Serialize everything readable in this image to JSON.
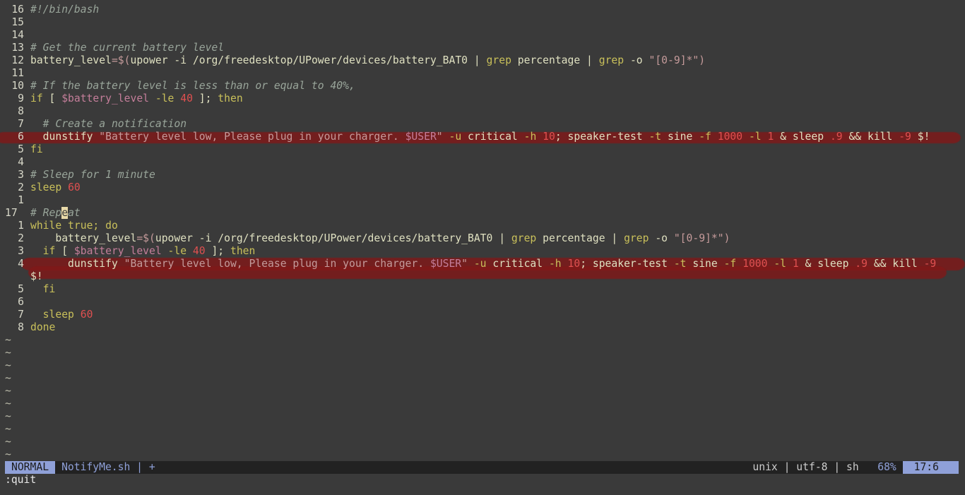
{
  "editor": {
    "lines": [
      {
        "num": "16",
        "tokens": [
          {
            "t": "#!/bin/bash",
            "c": "cm"
          }
        ]
      },
      {
        "num": "15",
        "tokens": []
      },
      {
        "num": "14",
        "tokens": []
      },
      {
        "num": "13",
        "tokens": [
          {
            "t": "# Get the current battery level",
            "c": "cm"
          }
        ]
      },
      {
        "num": "12",
        "tokens": [
          {
            "t": "battery_level",
            "c": "fn"
          },
          {
            "t": "=$(",
            "c": "str"
          },
          {
            "t": "upower ",
            "c": "fn"
          },
          {
            "t": "-i /org/freedesktop/UPower/devices/battery_BAT0 ",
            "c": "fn"
          },
          {
            "t": "| ",
            "c": "fn"
          },
          {
            "t": "grep ",
            "c": "kw"
          },
          {
            "t": "percentage ",
            "c": "fn"
          },
          {
            "t": "| ",
            "c": "fn"
          },
          {
            "t": "grep ",
            "c": "kw"
          },
          {
            "t": "-o ",
            "c": "fn"
          },
          {
            "t": "\"[0-9]*\")",
            "c": "str"
          }
        ]
      },
      {
        "num": "11",
        "tokens": []
      },
      {
        "num": "10",
        "tokens": [
          {
            "t": "# If the battery level is less than or equal to 40%,",
            "c": "cm"
          }
        ]
      },
      {
        "num": "9",
        "tokens": [
          {
            "t": "if",
            "c": "kw"
          },
          {
            "t": " [ ",
            "c": "fn"
          },
          {
            "t": "$battery_level",
            "c": "vr"
          },
          {
            "t": " -le ",
            "c": "fl"
          },
          {
            "t": "40",
            "c": "num"
          },
          {
            "t": " ]; ",
            "c": "fn"
          },
          {
            "t": "then",
            "c": "kw"
          }
        ]
      },
      {
        "num": "8",
        "tokens": []
      },
      {
        "num": "7",
        "tokens": [
          {
            "t": "  # Create a notification",
            "c": "cm"
          }
        ]
      },
      {
        "num": "6",
        "redact": true,
        "tokens": [
          {
            "t": "  dunstify ",
            "c": "fn"
          },
          {
            "t": "\"Battery level low, Please plug in your charger. ",
            "c": "str"
          },
          {
            "t": "$USER",
            "c": "vr"
          },
          {
            "t": "\"",
            "c": "str"
          },
          {
            "t": " -u ",
            "c": "fl"
          },
          {
            "t": "critical ",
            "c": "fn"
          },
          {
            "t": "-h ",
            "c": "fl"
          },
          {
            "t": "10",
            "c": "num"
          },
          {
            "t": "; speaker-test ",
            "c": "fn"
          },
          {
            "t": "-t ",
            "c": "fl"
          },
          {
            "t": "sine ",
            "c": "fn"
          },
          {
            "t": "-f ",
            "c": "fl"
          },
          {
            "t": "1000",
            "c": "num"
          },
          {
            "t": " -l ",
            "c": "fl"
          },
          {
            "t": "1",
            "c": "num"
          },
          {
            "t": " & sleep ",
            "c": "fn"
          },
          {
            "t": ".9",
            "c": "num"
          },
          {
            "t": " && kill ",
            "c": "fn"
          },
          {
            "t": "-9",
            "c": "num"
          },
          {
            "t": " $!",
            "c": "fn"
          }
        ]
      },
      {
        "num": "5",
        "tokens": [
          {
            "t": "fi",
            "c": "kw"
          }
        ]
      },
      {
        "num": "4",
        "tokens": []
      },
      {
        "num": "3",
        "tokens": [
          {
            "t": "# Sleep for 1 minute",
            "c": "cm"
          }
        ]
      },
      {
        "num": "2",
        "tokens": [
          {
            "t": "sleep ",
            "c": "kw"
          },
          {
            "t": "60",
            "c": "num"
          }
        ]
      },
      {
        "num": "1",
        "tokens": []
      },
      {
        "num": "17",
        "current": true,
        "tokens": [
          {
            "t": "# Rep",
            "c": "cm"
          },
          {
            "t": "e",
            "c": "cursor"
          },
          {
            "t": "at",
            "c": "cm"
          }
        ]
      },
      {
        "num": "1",
        "tokens": [
          {
            "t": "while",
            "c": "kw"
          },
          {
            "t": " true; ",
            "c": "kw"
          },
          {
            "t": "do",
            "c": "kw"
          }
        ]
      },
      {
        "num": "2",
        "tokens": [
          {
            "t": "    battery_level",
            "c": "fn"
          },
          {
            "t": "=$(",
            "c": "str"
          },
          {
            "t": "upower ",
            "c": "fn"
          },
          {
            "t": "-i /org/freedesktop/UPower/devices/battery_BAT0 ",
            "c": "fn"
          },
          {
            "t": "| ",
            "c": "fn"
          },
          {
            "t": "grep ",
            "c": "kw"
          },
          {
            "t": "percentage ",
            "c": "fn"
          },
          {
            "t": "| ",
            "c": "fn"
          },
          {
            "t": "grep ",
            "c": "kw"
          },
          {
            "t": "-o ",
            "c": "fn"
          },
          {
            "t": "\"[0-9]*\")",
            "c": "str"
          }
        ]
      },
      {
        "num": "3",
        "tokens": [
          {
            "t": "  if",
            "c": "kw"
          },
          {
            "t": " [ ",
            "c": "fn"
          },
          {
            "t": "$battery_level",
            "c": "vr"
          },
          {
            "t": " -le ",
            "c": "fl"
          },
          {
            "t": "40",
            "c": "num"
          },
          {
            "t": " ]; ",
            "c": "fn"
          },
          {
            "t": "then",
            "c": "kw"
          }
        ]
      },
      {
        "num": "4",
        "redact": true,
        "tokens": [
          {
            "t": "      dunstify ",
            "c": "fn"
          },
          {
            "t": "\"Battery level low, Please plug in your charger. ",
            "c": "str"
          },
          {
            "t": "$USER",
            "c": "vr"
          },
          {
            "t": "\"",
            "c": "str"
          },
          {
            "t": " -u ",
            "c": "fl"
          },
          {
            "t": "critical ",
            "c": "fn"
          },
          {
            "t": "-h ",
            "c": "fl"
          },
          {
            "t": "10",
            "c": "num"
          },
          {
            "t": "; speaker-test ",
            "c": "fn"
          },
          {
            "t": "-t ",
            "c": "fl"
          },
          {
            "t": "sine ",
            "c": "fn"
          },
          {
            "t": "-f ",
            "c": "fl"
          },
          {
            "t": "1000",
            "c": "num"
          },
          {
            "t": " -l ",
            "c": "fl"
          },
          {
            "t": "1",
            "c": "num"
          },
          {
            "t": " & sleep ",
            "c": "fn"
          },
          {
            "t": ".9",
            "c": "num"
          },
          {
            "t": " && kill ",
            "c": "fn"
          },
          {
            "t": "-9",
            "c": "num"
          }
        ]
      },
      {
        "num": "",
        "redact": true,
        "tokens": [
          {
            "t": "$!",
            "c": "fn"
          }
        ]
      },
      {
        "num": "5",
        "tokens": [
          {
            "t": "  fi",
            "c": "kw"
          }
        ]
      },
      {
        "num": "6",
        "tokens": []
      },
      {
        "num": "7",
        "tokens": [
          {
            "t": "  sleep ",
            "c": "kw"
          },
          {
            "t": "60",
            "c": "num"
          }
        ]
      },
      {
        "num": "8",
        "tokens": [
          {
            "t": "done",
            "c": "kw"
          }
        ]
      }
    ],
    "tilde": "~",
    "tilde_count": 10
  },
  "statusline": {
    "mode": "NORMAL",
    "filename": "NotifyMe.sh | +",
    "format": "unix | utf-8 | sh",
    "percent": "68%",
    "position": "17:6"
  },
  "cmdline": ":quit",
  "colors": {
    "background": "#3a3a3a",
    "statusline_bg": "#222222",
    "accent": "#8fa0d8",
    "redaction": "#801818"
  }
}
